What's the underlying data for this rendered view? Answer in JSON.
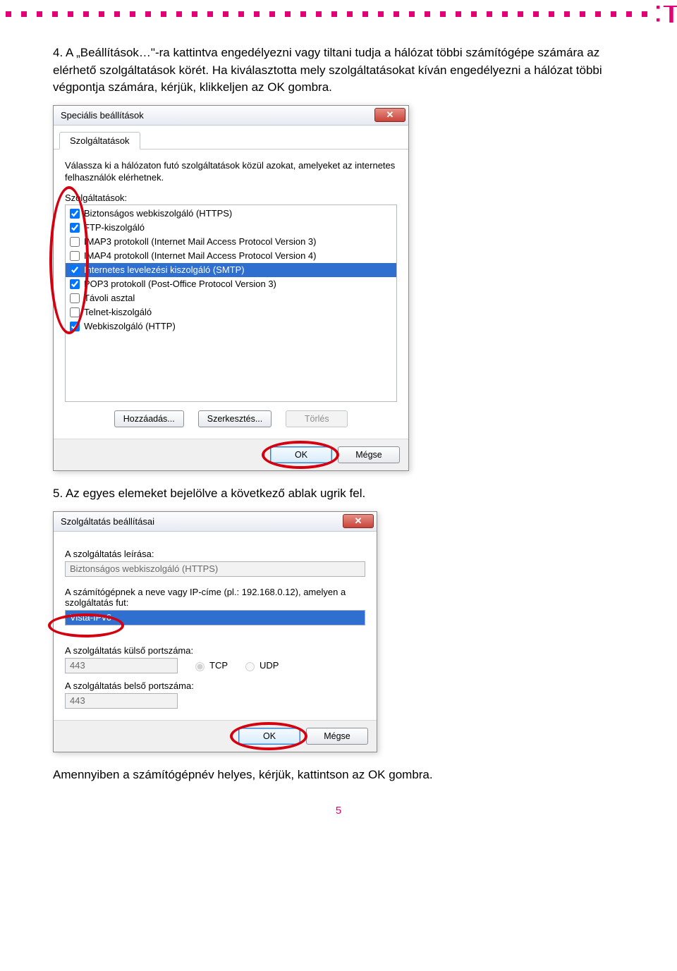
{
  "header_brand": "T",
  "para4": "4. A „Beállítások…\"-ra kattintva engedélyezni vagy tiltani tudja a hálózat többi számítógépe számára az elérhető szolgáltatások körét. Ha kiválasztotta mely szolgáltatásokat kíván engedélyezni a hálózat többi végpontja számára, kérjük, klikkeljen az OK gombra.",
  "dlg1": {
    "title": "Speciális beállítások",
    "tab": "Szolgáltatások",
    "instruction": "Válassza ki a hálózaton futó szolgáltatások közül azokat, amelyeket az internetes felhasználók elérhetnek.",
    "list_label": "Szolgáltatások:",
    "items": [
      {
        "checked": true,
        "selected": false,
        "label": "Biztonságos webkiszolgáló (HTTPS)"
      },
      {
        "checked": true,
        "selected": false,
        "label": "FTP-kiszolgáló"
      },
      {
        "checked": false,
        "selected": false,
        "label": "IMAP3 protokoll (Internet Mail Access Protocol Version 3)"
      },
      {
        "checked": false,
        "selected": false,
        "label": "IMAP4 protokoll (Internet Mail Access Protocol Version 4)"
      },
      {
        "checked": true,
        "selected": true,
        "label": "Internetes levelezési kiszolgáló (SMTP)"
      },
      {
        "checked": true,
        "selected": false,
        "label": "POP3 protokoll (Post-Office Protocol Version 3)"
      },
      {
        "checked": false,
        "selected": false,
        "label": "Távoli asztal"
      },
      {
        "checked": false,
        "selected": false,
        "label": "Telnet-kiszolgáló"
      },
      {
        "checked": true,
        "selected": false,
        "label": "Webkiszolgáló (HTTP)"
      }
    ],
    "btn_add": "Hozzáadás...",
    "btn_edit": "Szerkesztés...",
    "btn_delete": "Törlés",
    "btn_ok": "OK",
    "btn_cancel": "Mégse"
  },
  "para5": "5. Az egyes elemeket bejelölve a következő ablak ugrik fel.",
  "dlg2": {
    "title": "Szolgáltatás beállításai",
    "lbl_desc": "A szolgáltatás leírása:",
    "val_desc": "Biztonságos webkiszolgáló (HTTPS)",
    "lbl_host": "A számítógépnek a neve vagy IP-címe (pl.: 192.168.0.12), amelyen a szolgáltatás fut:",
    "val_host": "Vista-IPv6",
    "lbl_ext": "A szolgáltatás külső portszáma:",
    "val_ext": "443",
    "tcp": "TCP",
    "udp": "UDP",
    "lbl_int": "A szolgáltatás belső portszáma:",
    "val_int": "443",
    "btn_ok": "OK",
    "btn_cancel": "Mégse"
  },
  "para_after": "Amennyiben a számítógépnév helyes, kérjük, kattintson az OK gombra.",
  "page_number": "5"
}
